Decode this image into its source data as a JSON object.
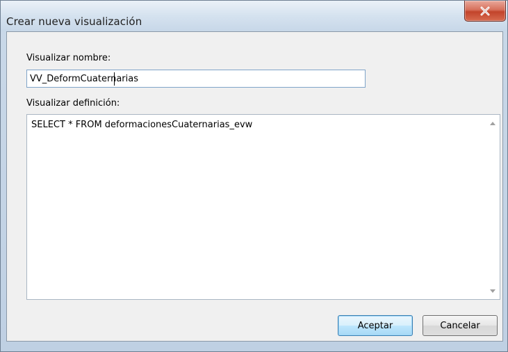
{
  "dialog": {
    "title": "Crear nueva visualización",
    "close_icon": "close-icon"
  },
  "form": {
    "name_label": "Visualizar nombre:",
    "name_value": "VV_DeformCuaternarias",
    "definition_label": "Visualizar definición:",
    "definition_value": "SELECT * FROM deformacionesCuaternarias_evw"
  },
  "buttons": {
    "accept_label": "Aceptar",
    "cancel_label": "Cancelar"
  },
  "colors": {
    "close_button": "#c2442b",
    "default_button_border": "#3c7fb1",
    "input_border": "#7fa4c9"
  }
}
